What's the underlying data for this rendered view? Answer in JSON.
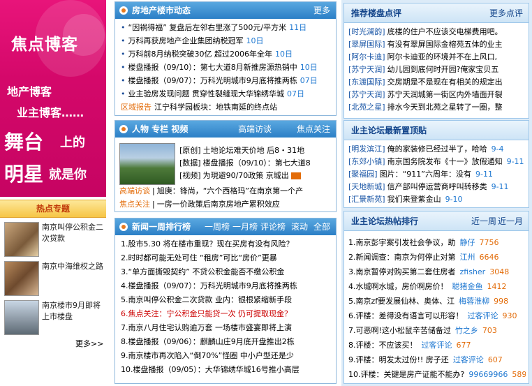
{
  "left": {
    "banner": {
      "title": "焦点博客",
      "line1": "地产博客",
      "line2": "业主博客……",
      "line3a": "舞台",
      "line3b": "上的",
      "line4a": "明星",
      "line4b": "就是你"
    },
    "hot_title": "热点专题",
    "hot_items": [
      "南京叫停公积金二次贷款",
      "南京中海维权之路",
      "南京楼市9月即将上市楼盘"
    ],
    "more": "更多>>"
  },
  "news": {
    "title": "房地产楼市动态",
    "more": "更多",
    "items": [
      {
        "text": "“因祸得福” 复盘后左邻右里涨了500元/平方米",
        "date": "11日"
      },
      {
        "text": "万科再获房地产企业集团纳税冠军",
        "date": "10日"
      },
      {
        "text": "万科前8月纳税突破30亿 超过2006年全年",
        "date": "10日"
      },
      {
        "text": "楼盘播报（09/10）：第七大道8月新推房源热销中",
        "date": "10日"
      },
      {
        "text": "楼盘播报（09/07）：万科光明城市9月底将推两栋",
        "date": "07日"
      },
      {
        "text": "业主验房发现问题 贯穿性裂缝现大华锦绣华城",
        "date": "07日"
      }
    ],
    "last_tag": "区域报告",
    "last_text": "江宁科学园板块：地铁南延的终点站"
  },
  "people": {
    "title": "人物 专栏 视频",
    "more1": "高端访谈",
    "more2": "焦点关注",
    "lines": [
      {
        "tag": "[原创]",
        "text": "土地论坛难"
      },
      {
        "tag": "[数据]",
        "text": "楼盘播报（09/10）：第七大道8"
      },
      {
        "tag": "[视频]",
        "text": "为現避90/70政策 京城出"
      }
    ],
    "line1_extra": "天价地 后8・31地",
    "talk_tag": "高端访谈",
    "talk_text": "旭庚：锋尚，“六个西格玛”在南京第一个产",
    "focus_tag": "焦点关注",
    "focus_text": "一房一价政策后南京房地产累积效应"
  },
  "rank": {
    "title": "新闻一周排行榜",
    "tabs": [
      "一周榜",
      "一月榜",
      "评论榜",
      "滚动",
      "全部"
    ],
    "items": [
      "1.股市5.30 将在楼市重现？现在买房有没有风险？",
      "2.时时都可能无处可住 “租房”可比“房价”更暴",
      "3.“单方面撕毁契约” 不贷公积金能否不缴公积金",
      "4.楼盘播报（09/07）：万科光明城市9月底将推两栋",
      "5.南京叫停公积金二次贷款 业内：银根紧缩新手段",
      "6.焦点关注：宁公积金只能贷一次 仍可提取现金？",
      "7.南京八月住宅认购逾万套 一场楼市盛宴即将上演",
      "8.楼盘播报（09/06）：麒麟山庄9月底开盘推出2栋",
      "9.南京楼市再次陷入“倒70%”怪圈 中小户型还是少",
      "10.楼盘播报（09/05）：大华锦绣华城16号推小高层"
    ]
  },
  "review": {
    "title": "推荐楼盘点评",
    "more": "更多点评",
    "items": [
      {
        "tag": "[时光澜韵]",
        "text": "底楼的住户不应该交电梯费用吧。"
      },
      {
        "tag": "[翠屏国际]",
        "text": "有没有翠屏国际金榕苑五体的业主"
      },
      {
        "tag": "[阿尔卡迪]",
        "text": "阿尔卡迪亚的环境并不在上风口,"
      },
      {
        "tag": "[苏宁天润]",
        "text": "幼儿园到底何时开园?俺家宝贝五"
      },
      {
        "tag": "[东渡国际]",
        "text": "交房期是不是现在有相关的规定出"
      },
      {
        "tag": "[苏宁天润]",
        "text": "苏宁天润城第一街区内外墙面开裂"
      },
      {
        "tag": "[北苑之星]",
        "text": "排水今天到北苑之星转了一圈，整"
      }
    ]
  },
  "forum": {
    "title": "业主论坛最新置顶贴",
    "items": [
      {
        "tag": "[明发滨江]",
        "text": "俺的家装修已经过半了，哈哈",
        "date": "9-4"
      },
      {
        "tag": "[东郊小镇]",
        "text": "南京国务院发布《十一》放假通知",
        "date": "9-11"
      },
      {
        "tag": "[聚福园]",
        "text": "图片：“911”六周年：没有",
        "date": "9-11"
      },
      {
        "tag": "[天地新城]",
        "text": "信产部叫停运营商呼叫转移类",
        "date": "9-11"
      },
      {
        "tag": "[汇景新苑]",
        "text": "我们来登紫金山",
        "date": "9-10"
      }
    ]
  },
  "hot": {
    "title": "业主论坛热帖排行",
    "tab1": "近一周",
    "tab2": "近一月",
    "items": [
      {
        "text": "1.南京彭宇案引发社会争议，助",
        "user": "静仔",
        "count": "7756"
      },
      {
        "text": "2.新闻调查：南京为何停止对第",
        "user": "江州",
        "count": "6646"
      },
      {
        "text": "3.南京暂停对购买第二套住房者",
        "user": "zfisher",
        "count": "3048"
      },
      {
        "text": "4.水城啊水城，房价啊房价！",
        "user": "聪猪金鱼",
        "count": "1412"
      },
      {
        "text": "5.南京zf要发展仙林、奥体、江",
        "user": "梅蓉淮柳",
        "count": "998"
      },
      {
        "text": "6.评楼：差得没有语言可以形容！",
        "user": "过客评论",
        "count": "930"
      },
      {
        "text": "7.可恶啊!这小松鼠辛苦储备过",
        "user": "竹之乡",
        "count": "703"
      },
      {
        "text": "8.评楼：不应该买！",
        "user": "过客评论",
        "count": "677"
      },
      {
        "text": "9.评楼：明发太过份!! 房子还",
        "user": "过客评论",
        "count": "607"
      },
      {
        "text": "10.评楼：关键是房产证能不能办?",
        "user": "99669966",
        "count": "589"
      }
    ]
  },
  "colors": {
    "banner_pink": "#d4086a",
    "header_blue": "#2b7fc6",
    "accent_orange": "#e36c09",
    "red": "#cc0000",
    "right_bg": "#dcebf8"
  }
}
